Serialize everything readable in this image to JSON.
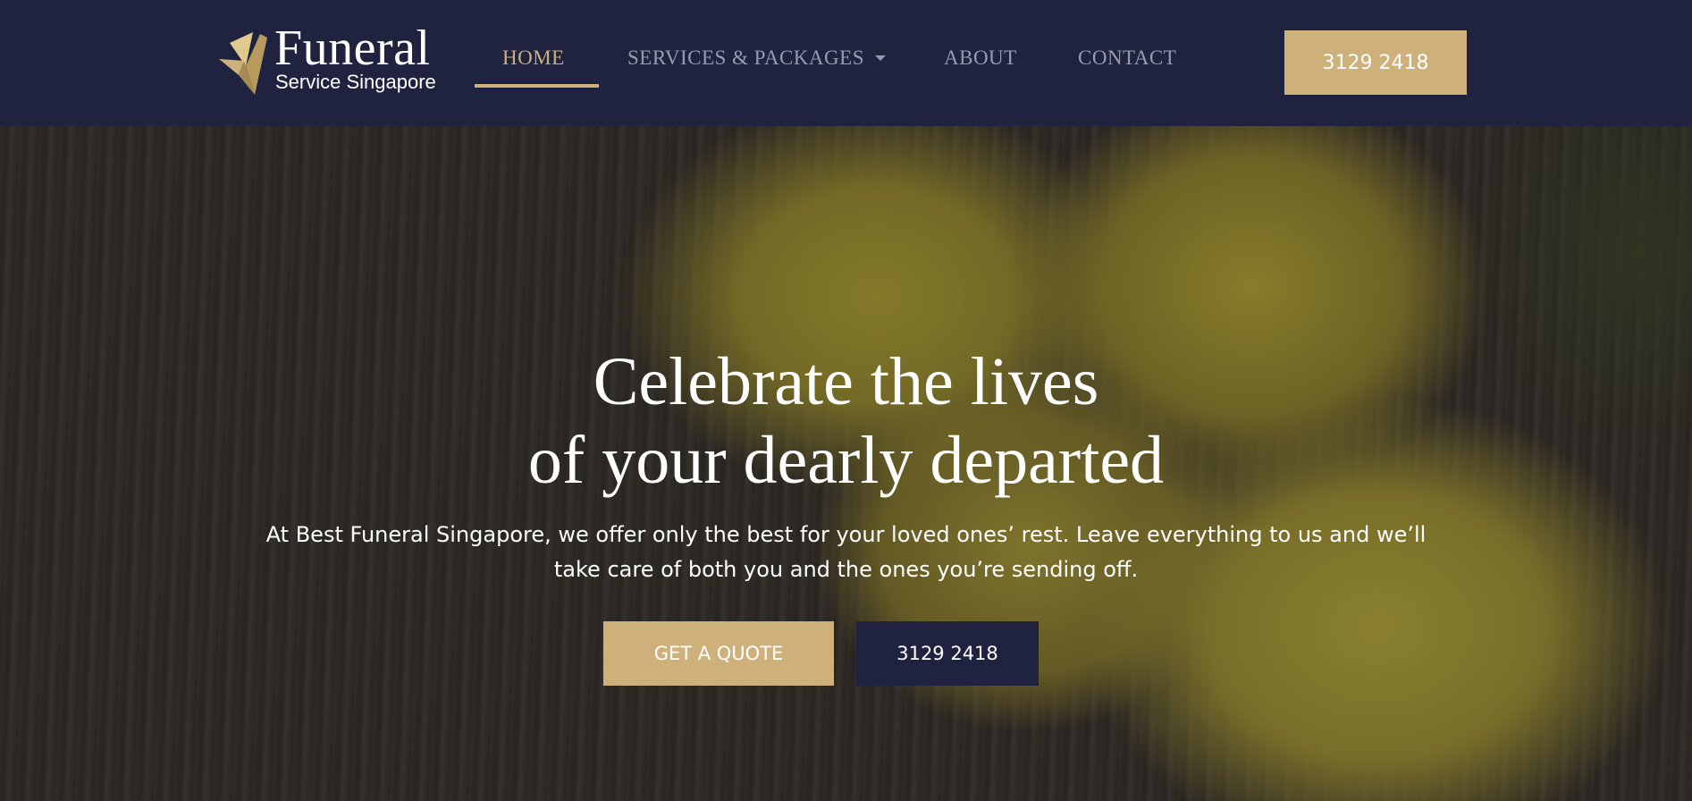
{
  "header": {
    "logo": {
      "title": "Funeral",
      "subtitle": "Service Singapore"
    },
    "nav": {
      "home": "HOME",
      "services": "SERVICES & PACKAGES",
      "about": "ABOUT",
      "contact": "CONTACT"
    },
    "phone_button": "3129 2418"
  },
  "hero": {
    "title_line1": "Celebrate the lives",
    "title_line2": "of your dearly departed",
    "text_line1": "At Best Funeral Singapore, we offer only the best for your loved ones’ rest. Leave everything to us and we’ll",
    "text_line2": "take care of both you and the ones you’re sending off.",
    "quote_button": "GET A QUOTE",
    "phone_button": "3129 2418"
  },
  "colors": {
    "navy": "#1f2340",
    "gold": "#cdb07a",
    "nav_inactive": "#9a9cab"
  },
  "icons": {
    "logo_mark": "origami-crane-icon",
    "dropdown": "caret-down-icon"
  }
}
